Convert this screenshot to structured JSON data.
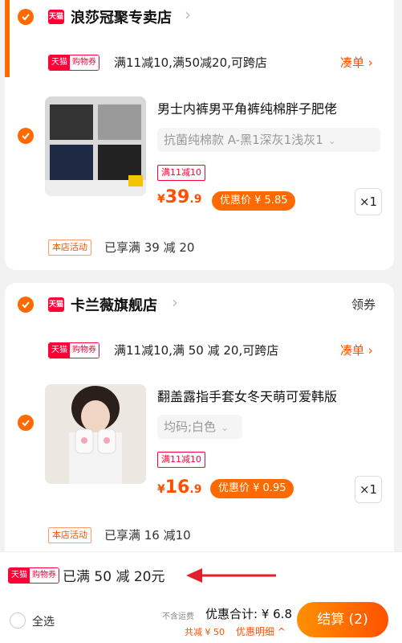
{
  "stores": [
    {
      "name": "浪莎冠聚专卖店",
      "logo_text": "天猫",
      "coupon_tag": {
        "part1": "天猫",
        "part2": "购物券"
      },
      "promo": "满11减10,满50减20,可跨店",
      "coudan": "凑单 ›",
      "item": {
        "title": "男士内裤男平角裤纯棉胖子肥佬",
        "sku": "抗菌纯棉款 A-黑1深灰1浅灰1",
        "discount_tag": "满11减10",
        "price": {
          "currency": "¥",
          "int": "39",
          "dec": ".9"
        },
        "deal_price": "优惠价 ¥ 5.85",
        "qty": "×1"
      },
      "shop_promo_tag": "本店活动",
      "shop_promo_text": "已享满 39 减 20"
    },
    {
      "name": "卡兰薇旗舰店",
      "logo_text": "天猫",
      "lingquan": "领券",
      "coupon_tag": {
        "part1": "天猫",
        "part2": "购物券"
      },
      "promo": "满11减10,满 50 减 20,可跨店",
      "coudan": "凑单 ›",
      "item": {
        "title": "翻盖露指手套女冬天萌可爱韩版",
        "sku": "均码;白色",
        "discount_tag": "满11减10",
        "price": {
          "currency": "¥",
          "int": "16",
          "dec": ".9"
        },
        "deal_price": "优惠价 ¥ 0.95",
        "qty": "×1"
      },
      "shop_promo_tag": "本店活动",
      "shop_promo_text": "已享满 16 减10"
    }
  ],
  "summary": {
    "coupon_tag": {
      "part1": "天猫",
      "part2": "购物券"
    },
    "text": "已满 50 减 20元"
  },
  "footer": {
    "select_all": "全选",
    "shipping_note": "不含运费",
    "discount_total": "优惠合计: ¥ 6.8",
    "total_reduction": "共减 ¥ 50",
    "detail_link": "优惠明细 ^",
    "checkout": "结算 (2)"
  },
  "colors": {
    "accent": "#ff6a00",
    "tmall_red": "#ff0036",
    "price": "#ff5000"
  },
  "icons": [
    "check-icon",
    "tmall-logo",
    "chevron-right-icon",
    "caret-down-icon",
    "red-arrow-icon"
  ]
}
